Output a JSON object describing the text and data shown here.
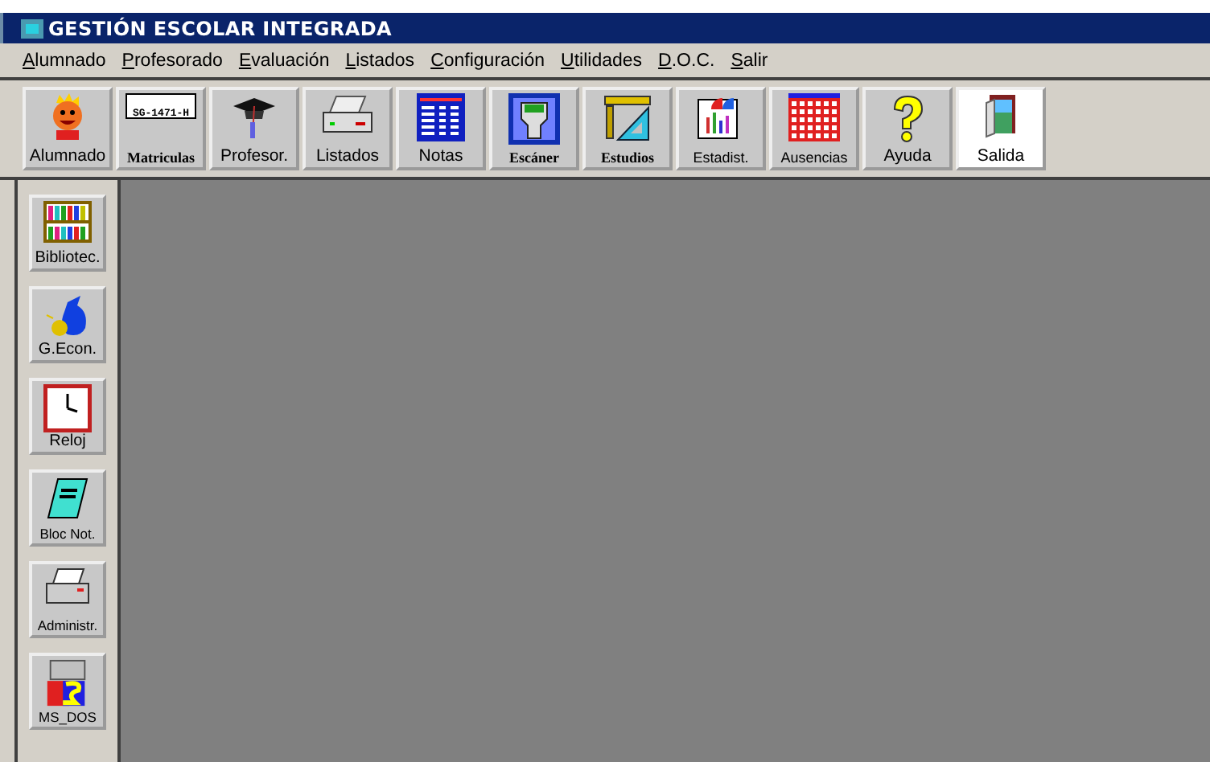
{
  "window": {
    "title": "GESTIÓN ESCOLAR INTEGRADA"
  },
  "menu": [
    "Alumnado",
    "Profesorado",
    "Evaluación",
    "Listados",
    "Configuración",
    "Utilidades",
    "D.O.C.",
    "Salir"
  ],
  "toolbar": [
    "Alumnado",
    "Matriculas",
    "Profesor.",
    "Listados",
    "Notas",
    "Escáner",
    "Estudios",
    "Estadist.",
    "Ausencias",
    "Ayuda",
    "Salida"
  ],
  "badge_text": "SG-1471-H",
  "sidebar": [
    "Bibliotec.",
    "G.Econ.",
    "Reloj",
    "Bloc Not.",
    "Administr.",
    "MS_DOS"
  ]
}
